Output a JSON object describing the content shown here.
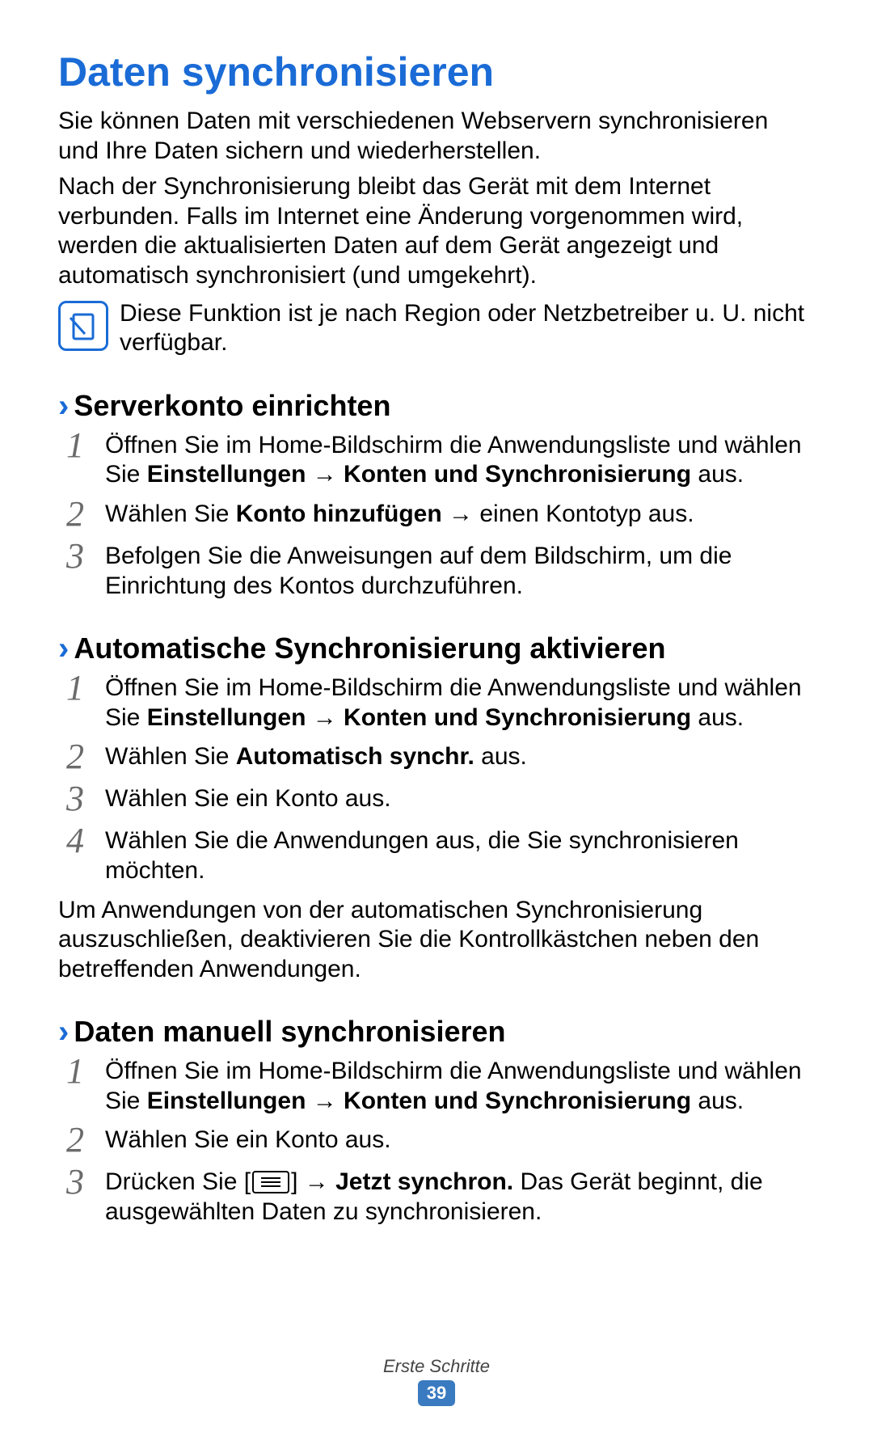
{
  "title": "Daten synchronisieren",
  "intro_paragraphs": [
    "Sie können Daten mit verschiedenen Webservern synchronisieren und Ihre Daten sichern und wiederherstellen.",
    "Nach der Synchronisierung bleibt das Gerät mit dem Internet verbunden. Falls im Internet eine Änderung vorgenommen wird, werden die aktualisierten Daten auf dem Gerät angezeigt und automatisch synchronisiert (und umgekehrt)."
  ],
  "note": "Diese Funktion ist je nach Region oder Netzbetreiber u. U. nicht verfügbar.",
  "sections": [
    {
      "heading": "Serverkonto einrichten",
      "steps": [
        {
          "num": "1",
          "pre": "Öffnen Sie im Home-Bildschirm die Anwendungsliste und wählen Sie ",
          "bold": "Einstellungen → Konten und Synchronisierung",
          "post": " aus."
        },
        {
          "num": "2",
          "pre": "Wählen Sie ",
          "bold": "Konto hinzufügen",
          "post": " → einen Kontotyp aus."
        },
        {
          "num": "3",
          "pre": "Befolgen Sie die Anweisungen auf dem Bildschirm, um die Einrichtung des Kontos durchzuführen.",
          "bold": "",
          "post": ""
        }
      ]
    },
    {
      "heading": "Automatische Synchronisierung aktivieren",
      "steps": [
        {
          "num": "1",
          "pre": "Öffnen Sie im Home-Bildschirm die Anwendungsliste und wählen Sie ",
          "bold": "Einstellungen → Konten und Synchronisierung",
          "post": " aus."
        },
        {
          "num": "2",
          "pre": "Wählen Sie ",
          "bold": "Automatisch synchr.",
          "post": " aus."
        },
        {
          "num": "3",
          "pre": "Wählen Sie ein Konto aus.",
          "bold": "",
          "post": ""
        },
        {
          "num": "4",
          "pre": "Wählen Sie die Anwendungen aus, die Sie synchronisieren möchten.",
          "bold": "",
          "post": ""
        }
      ],
      "after": "Um Anwendungen von der automatischen Synchronisierung auszuschließen, deaktivieren Sie die Kontrollkästchen neben den betreffenden Anwendungen."
    },
    {
      "heading": "Daten manuell synchronisieren",
      "steps": [
        {
          "num": "1",
          "pre": "Öffnen Sie im Home-Bildschirm die Anwendungsliste und wählen Sie ",
          "bold": "Einstellungen → Konten und Synchronisierung",
          "post": " aus."
        },
        {
          "num": "2",
          "pre": "Wählen Sie ein Konto aus.",
          "bold": "",
          "post": ""
        },
        {
          "num": "3",
          "pre": "Drücken Sie [",
          "icon": true,
          "mid": "] → ",
          "bold": "Jetzt synchron.",
          "post": " Das Gerät beginnt, die ausgewählten Daten zu synchronisieren."
        }
      ]
    }
  ],
  "footer": {
    "section": "Erste Schritte",
    "page": "39"
  }
}
